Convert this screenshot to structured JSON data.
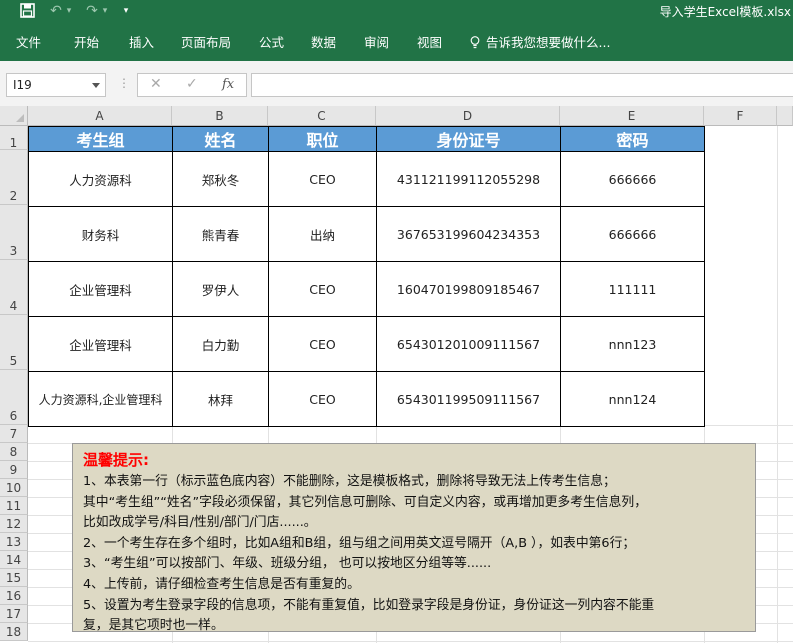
{
  "titlebar": {
    "title": "导入学生Excel模板.xlsx",
    "undo_glyph": "↶",
    "redo_glyph": "↷",
    "more_glyph": "▾"
  },
  "ribbon": {
    "tabs": [
      "文件",
      "开始",
      "插入",
      "页面布局",
      "公式",
      "数据",
      "审阅",
      "视图"
    ],
    "tell_me": "告诉我您想要做什么..."
  },
  "formula_bar": {
    "name_box": "I19",
    "dots": "⋮",
    "cancel_glyph": "✕",
    "enter_glyph": "✓",
    "fx_label": "fx",
    "value": ""
  },
  "sheet": {
    "columns": [
      "A",
      "B",
      "C",
      "D",
      "E",
      "F"
    ],
    "rows": [
      "1",
      "2",
      "3",
      "4",
      "5",
      "6",
      "7",
      "8",
      "9",
      "10",
      "11",
      "12",
      "13",
      "14",
      "15",
      "16",
      "17",
      "18"
    ],
    "headers": [
      "考生组",
      "姓名",
      "职位",
      "身份证号",
      "密码"
    ],
    "records": [
      [
        "人力资源科",
        "郑秋冬",
        "CEO",
        "431121199112055298",
        "666666"
      ],
      [
        "财务科",
        "熊青春",
        "出纳",
        "367653199604234353",
        "666666"
      ],
      [
        "企业管理科",
        "罗伊人",
        "CEO",
        "160470199809185467",
        "111111"
      ],
      [
        "企业管理科",
        "白力勤",
        "CEO",
        "654301201009111567",
        "nnn123"
      ],
      [
        "人力资源科,企业管理科",
        "林拜",
        "CEO",
        "654301199509111567",
        "nnn124"
      ]
    ]
  },
  "notice": {
    "title": "温馨提示:",
    "lines": [
      "1、本表第一行（标示蓝色底内容）不能删除，这是模板格式，删除将导致无法上传考生信息；",
      "其中“考生组”“姓名”字段必须保留，其它列信息可删除、可自定义内容，或再增加更多考生信息列，",
      "比如改成学号/科目/性别/部门/门店......。",
      "2、一个考生存在多个组时，比如A组和B组，组与组之间用英文逗号隔开（A,B ），如表中第6行；",
      "3、“考生组”可以按部门、年级、班级分组， 也可以按地区分组等等......",
      "4、上传前，请仔细检查考生信息是否有重复的。",
      "5、设置为考生登录字段的信息项，不能有重复值，比如登录字段是身份证，身份证这一列内容不能重",
      "复，是其它项时也一样。"
    ]
  },
  "colors": {
    "app_green": "#217346",
    "header_fill": "#5b9bd5",
    "notice_fill": "#ddd9c4",
    "notice_title": "#ff0000"
  }
}
